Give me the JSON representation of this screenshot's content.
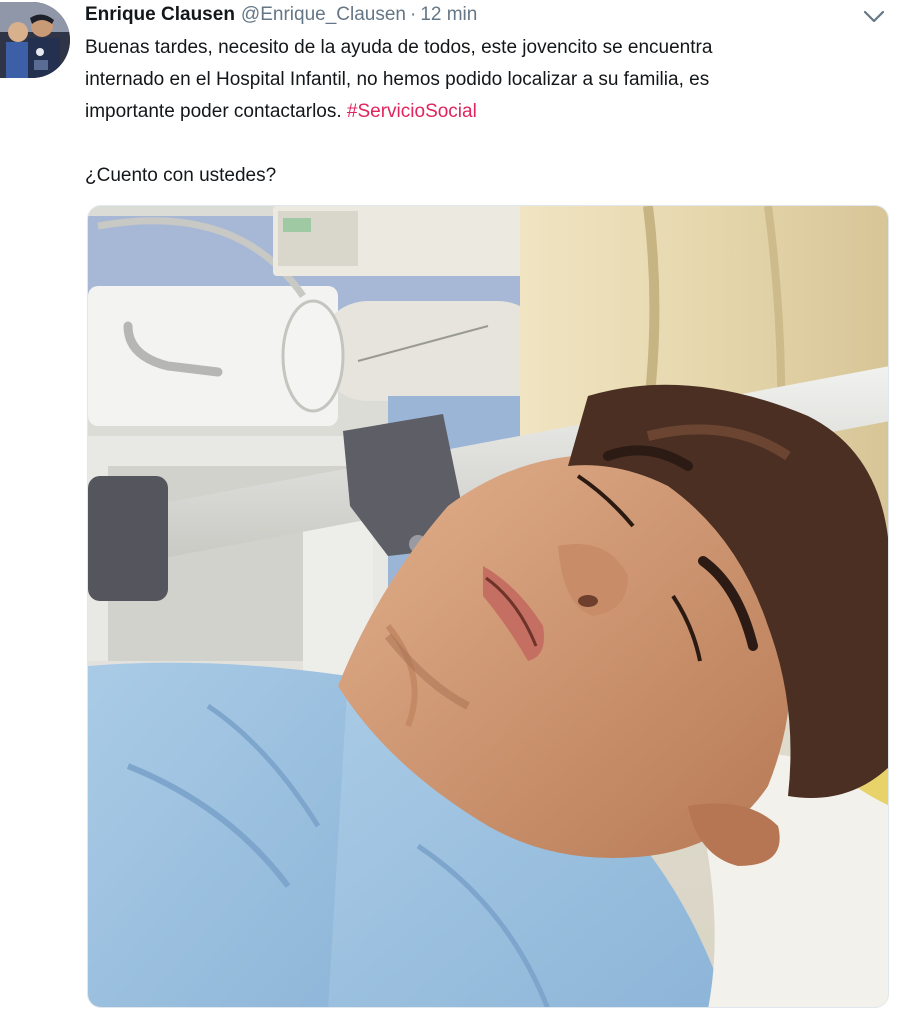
{
  "tweet": {
    "author": {
      "name": "Enrique Clausen",
      "handle": "@Enrique_Clausen",
      "avatar_icon": "user-avatar"
    },
    "separator": "·",
    "timestamp": "12 min",
    "menu_icon": "chevron-down-icon",
    "text": {
      "line1": "Buenas tardes, necesito de la ayuda de todos, este jovencito se encuentra",
      "line2": "internado en el Hospital Infantil, no hemos podido localizar a su familia, es",
      "line3_text": "importante poder contactarlos. ",
      "hashtag": "#ServicioSocial",
      "line4": "¿Cuento con ustedes?"
    },
    "media": {
      "kind": "photo"
    }
  },
  "colors": {
    "text": "#14171a",
    "muted": "#657786",
    "hashtag": "#e0245e",
    "border": "#e1e8ed"
  }
}
